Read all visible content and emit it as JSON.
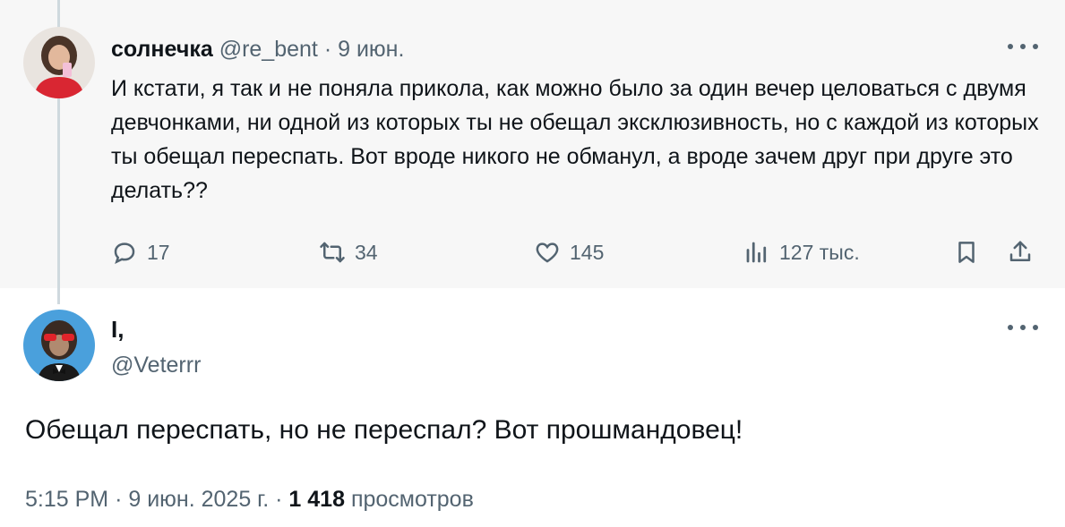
{
  "parent_tweet": {
    "display_name": "солнечка",
    "handle": "@re_bent",
    "separator": "·",
    "date": "9 июн.",
    "text": "И кстати, я так и не поняла прикола, как можно было за один вечер целоваться с двумя девчонками, ни одной из которых ты не обещал эксклюзивность, но с каждой из которых ты обещал переспать. Вот вроде никого не обманул, а вроде зачем друг при друге это делать??",
    "replies": "17",
    "retweets": "34",
    "likes": "145",
    "views": "127 тыс."
  },
  "reply_tweet": {
    "display_name": "I,",
    "handle": "@Veterrr",
    "text": "Обещал переспать, но не переспал? Вот прошмандовец!",
    "time": "5:15 PM",
    "separator": "·",
    "date": "9 июн. 2025 г.",
    "separator2": "·",
    "views_count": "1 418",
    "views_label": "просмотров"
  },
  "icons": {
    "reply": "reply-icon",
    "retweet": "retweet-icon",
    "like": "heart-icon",
    "views": "views-icon",
    "bookmark": "bookmark-icon",
    "share": "share-icon",
    "more": "more-icon"
  },
  "colors": {
    "muted": "#536471",
    "text": "#0f1419",
    "parent_background": "#f7f7f7",
    "thread_line": "#cfd9de"
  }
}
